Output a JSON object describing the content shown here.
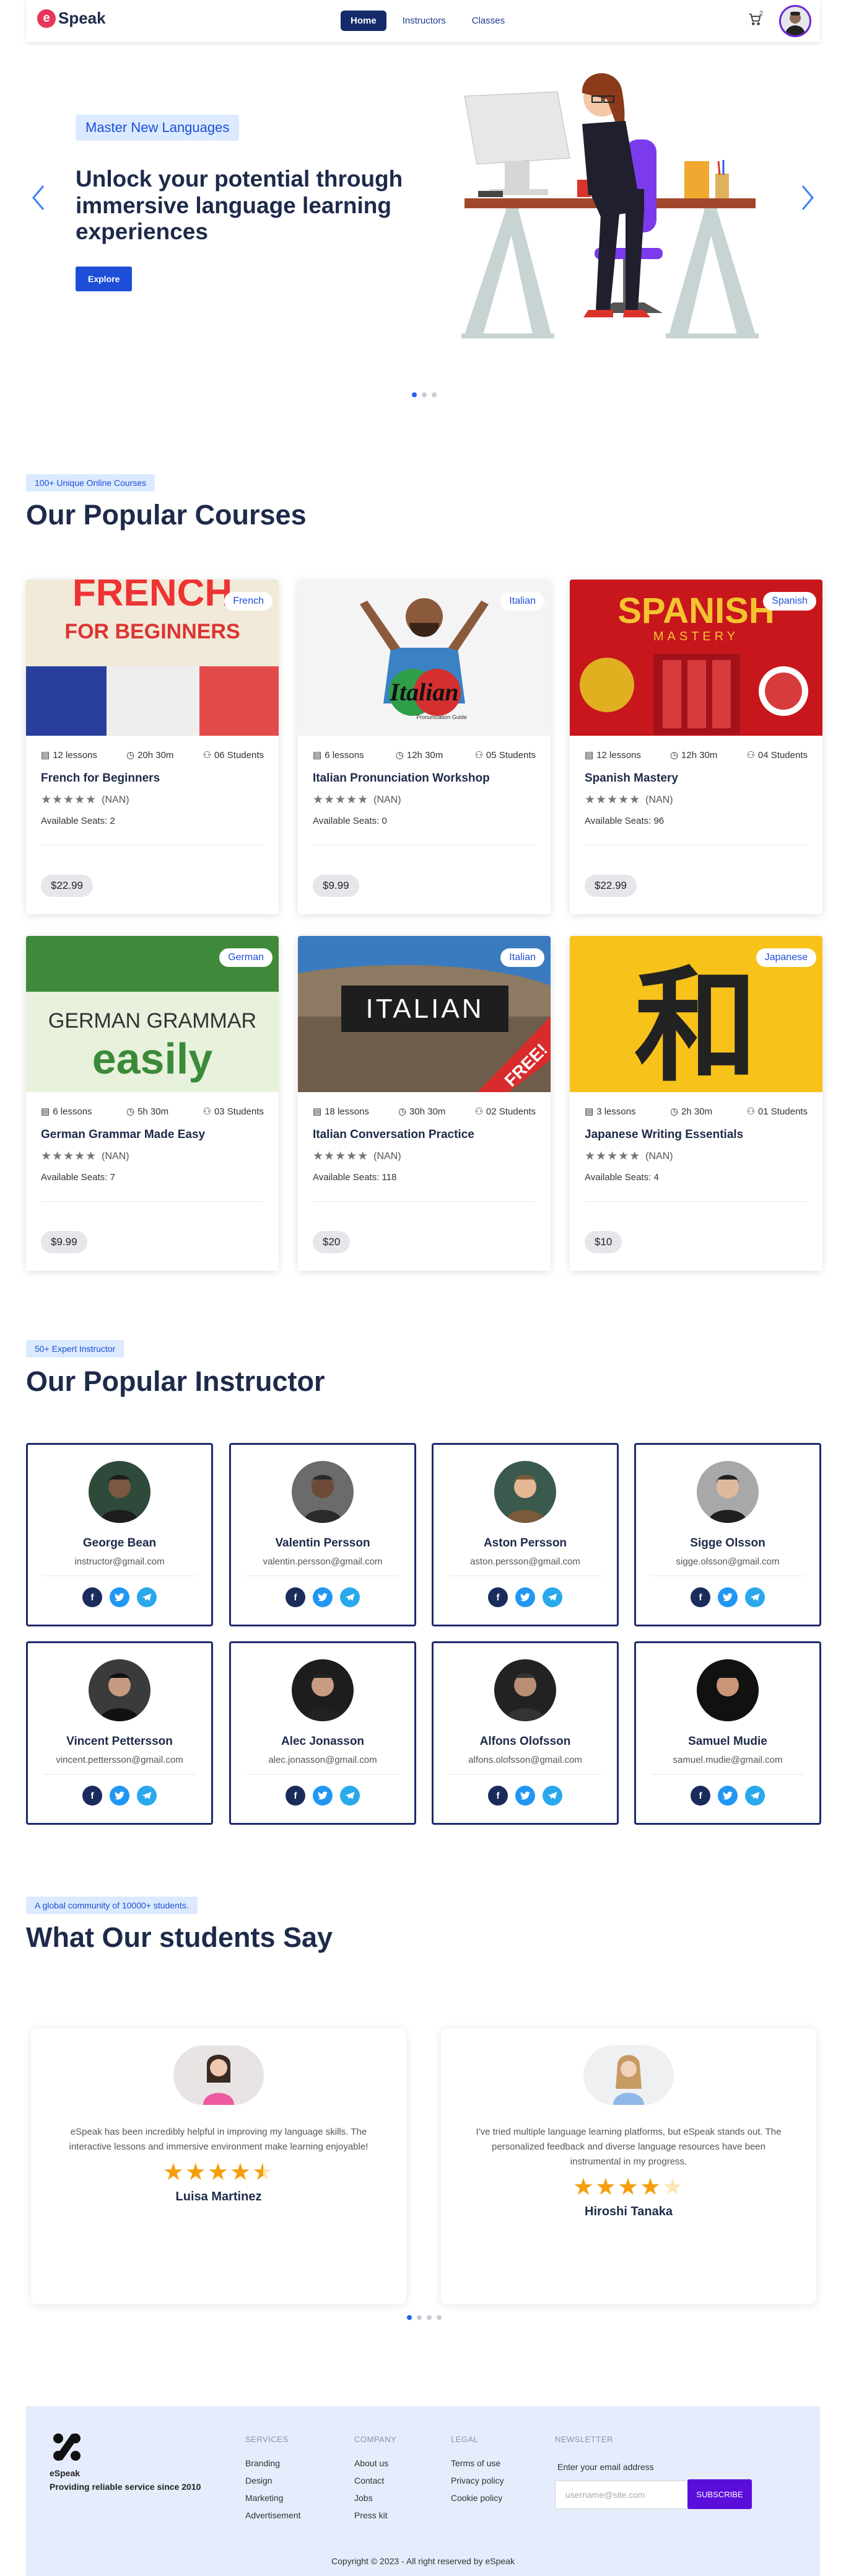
{
  "nav": {
    "logo_mark": "e",
    "logo_text": "Speak",
    "items": [
      {
        "label": "Home",
        "active": true
      },
      {
        "label": "Instructors",
        "active": false
      },
      {
        "label": "Classes",
        "active": false
      }
    ],
    "cart_count": "2"
  },
  "hero": {
    "badge": "Master New Languages",
    "title": "Unlock your potential through immersive language learning experiences",
    "button": "Explore",
    "slide_count": 3,
    "active_slide": 0
  },
  "courses_section": {
    "badge": "100+ Unique Online Courses",
    "title": "Our Popular Courses",
    "items": [
      {
        "lang": "French",
        "lessons": "12 lessons",
        "duration": "20h 30m",
        "students": "06 Students",
        "title": "French for Beginners",
        "rating": "(NAN)",
        "seats": "Available Seats: 2",
        "price": "$22.99",
        "img_text1": "FRENCH",
        "img_text2": "FOR BEGINNERS"
      },
      {
        "lang": "Italian",
        "lessons": "6 lessons",
        "duration": "12h 30m",
        "students": "05 Students",
        "title": "Italian Pronunciation Workshop",
        "rating": "(NAN)",
        "seats": "Available Seats: 0",
        "price": "$9.99",
        "img_text1": "Italian",
        "img_text2": "Pronunciation Guide"
      },
      {
        "lang": "Spanish",
        "lessons": "12 lessons",
        "duration": "12h 30m",
        "students": "04 Students",
        "title": "Spanish Mastery",
        "rating": "(NAN)",
        "seats": "Available Seats: 96",
        "price": "$22.99",
        "img_text1": "SPANISH",
        "img_text2": "MASTERY"
      },
      {
        "lang": "German",
        "lessons": "6 lessons",
        "duration": "5h 30m",
        "students": "03 Students",
        "title": "German Grammar Made Easy",
        "rating": "(NAN)",
        "seats": "Available Seats: 7",
        "price": "$9.99",
        "img_text1": "GERMAN GRAMMAR",
        "img_text2": "easily"
      },
      {
        "lang": "Italian",
        "lessons": "18 lessons",
        "duration": "30h 30m",
        "students": "02 Students",
        "title": "Italian Conversation Practice",
        "rating": "(NAN)",
        "seats": "Available Seats: 118",
        "price": "$20",
        "img_text1": "ITALIAN",
        "img_text2": "FREE!"
      },
      {
        "lang": "Japanese",
        "lessons": "3 lessons",
        "duration": "2h 30m",
        "students": "01 Students",
        "title": "Japanese Writing Essentials",
        "rating": "(NAN)",
        "seats": "Available Seats: 4",
        "price": "$10",
        "img_text1": "和",
        "img_text2": ""
      }
    ]
  },
  "instructors_section": {
    "badge": "50+ Expert Instructor",
    "title": "Our Popular Instructor",
    "items": [
      {
        "name": "George Bean",
        "email": "instructor@gmail.com"
      },
      {
        "name": "Valentin Persson",
        "email": "valentin.persson@gmail.com"
      },
      {
        "name": "Aston Persson",
        "email": "aston.persson@gmail.com"
      },
      {
        "name": "Sigge Olsson",
        "email": "sigge.olsson@gmail.com"
      },
      {
        "name": "Vincent Pettersson",
        "email": "vincent.pettersson@gmail.com"
      },
      {
        "name": "Alec Jonasson",
        "email": "alec.jonasson@gmail.com"
      },
      {
        "name": "Alfons Olofsson",
        "email": "alfons.olofsson@gmail.com"
      },
      {
        "name": "Samuel Mudie",
        "email": "samuel.mudie@gmail.com"
      }
    ]
  },
  "testimonials_section": {
    "badge": "A global community of 10000+ students.",
    "title": "What Our students Say",
    "items": [
      {
        "text": "eSpeak has been incredibly helpful in improving my language skills. The interactive lessons and immersive environment make learning enjoyable!",
        "rating": 4.5,
        "name": "Luisa Martinez"
      },
      {
        "text": "I've tried multiple language learning platforms, but eSpeak stands out. The personalized feedback and diverse language resources have been instrumental in my progress.",
        "rating": 4,
        "name": "Hiroshi Tanaka"
      }
    ],
    "slide_count": 4,
    "active_slide": 0
  },
  "footer": {
    "brand": "eSpeak",
    "tagline": "Providing reliable service since 2010",
    "services_heading": "SERVICES",
    "services": [
      "Branding",
      "Design",
      "Marketing",
      "Advertisement"
    ],
    "company_heading": "COMPANY",
    "company": [
      "About us",
      "Contact",
      "Jobs",
      "Press kit"
    ],
    "legal_heading": "LEGAL",
    "legal": [
      "Terms of use",
      "Privacy policy",
      "Cookie policy"
    ],
    "newsletter_heading": "NEWSLETTER",
    "newsletter_label": "Enter your email address",
    "newsletter_placeholder": "username@site.com",
    "subscribe": "SUBSCRIBE",
    "copyright": "Copyright © 2023 - All right reserved by eSpeak"
  },
  "colors": {
    "primary": "#1d4ed8",
    "navy": "#1e2a4a",
    "accent_purple": "#5b0edb",
    "logo_pink": "#e8355a",
    "star_gold": "#f59e0b"
  }
}
